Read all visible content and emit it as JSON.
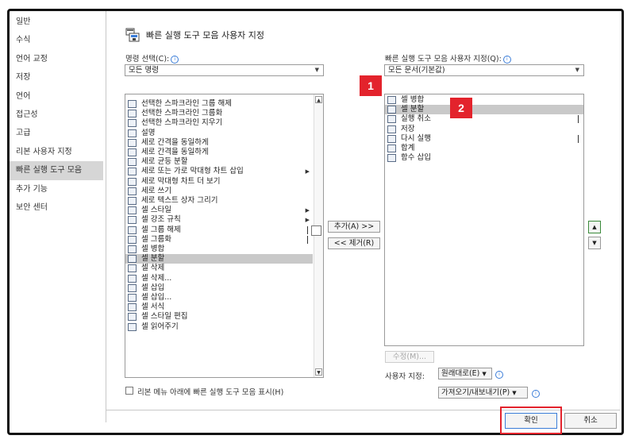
{
  "nav": {
    "items": [
      "일반",
      "수식",
      "언어 교정",
      "저장",
      "언어",
      "접근성",
      "고급",
      "리본 사용자 지정",
      "빠른 실행 도구 모음",
      "추가 기능",
      "보안 센터"
    ],
    "selected_index": 8
  },
  "header": {
    "title": "빠른 실행 도구 모음 사용자 지정"
  },
  "left": {
    "label": "명령 선택(C):",
    "dropdown_value": "모든 명령",
    "items": [
      {
        "label": "선택한 스파크라인 그룹 해제",
        "sub": ""
      },
      {
        "label": "선택한 스파크라인 그룹화",
        "sub": ""
      },
      {
        "label": "선택한 스파크라인 지우기",
        "sub": ""
      },
      {
        "label": "설명",
        "sub": ""
      },
      {
        "label": "세로 간격을 동일하게",
        "sub": ""
      },
      {
        "label": "세로 간격을 동일하게",
        "sub": ""
      },
      {
        "label": "세로 균등 분할",
        "sub": ""
      },
      {
        "label": "세로 또는 가로 막대형 차트 삽입",
        "sub": "arrow"
      },
      {
        "label": "세로 막대형 차트 더 보기",
        "sub": ""
      },
      {
        "label": "세로 쓰기",
        "sub": ""
      },
      {
        "label": "세로 텍스트 상자 그리기",
        "sub": ""
      },
      {
        "label": "셀 스타일",
        "sub": "arrow"
      },
      {
        "label": "셀 강조 규칙",
        "sub": "arrow"
      },
      {
        "label": "셀 그룹 해제",
        "sub": "bar"
      },
      {
        "label": "셀 그룹화",
        "sub": "bar"
      },
      {
        "label": "셀 병합",
        "sub": ""
      },
      {
        "label": "셀 분할",
        "sub": ""
      },
      {
        "label": "셀 삭제",
        "sub": ""
      },
      {
        "label": "셀 삭제...",
        "sub": ""
      },
      {
        "label": "셀 삽입",
        "sub": ""
      },
      {
        "label": "셀 삽입...",
        "sub": ""
      },
      {
        "label": "셀 서식",
        "sub": ""
      },
      {
        "label": "셀 스타일 편집",
        "sub": ""
      },
      {
        "label": "셀 읽어주기",
        "sub": ""
      }
    ],
    "selected_index": 16
  },
  "middle": {
    "add_label": "추가(A) >>",
    "remove_label": "<< 제거(R)"
  },
  "right": {
    "label": "빠른 실행 도구 모음 사용자 지정(Q):",
    "dropdown_value": "모든 문서(기본값)",
    "items": [
      {
        "label": "셀 병합",
        "sub": ""
      },
      {
        "label": "셀 분할",
        "sub": ""
      },
      {
        "label": "실행 취소",
        "sub": "bar"
      },
      {
        "label": "저장",
        "sub": ""
      },
      {
        "label": "다시 실행",
        "sub": "bar"
      },
      {
        "label": "합계",
        "sub": ""
      },
      {
        "label": "함수 삽입",
        "sub": ""
      }
    ],
    "selected_index": 1,
    "modify_label": "수정(M)...",
    "customize_label": "사용자 지정:",
    "reset_label": "원래대로(E)",
    "import_export_label": "가져오기/내보내기(P)"
  },
  "below_ribbon_label": "리본 메뉴 아래에 빠른 실행 도구 모음 표시(H)",
  "buttons": {
    "ok": "확인",
    "cancel": "취소"
  },
  "badges": {
    "one": "1",
    "two": "2"
  },
  "colors": {
    "accent": "#3b7dd8",
    "annotation_red": "#e3232c",
    "selection_gray": "#c9c9c9"
  }
}
